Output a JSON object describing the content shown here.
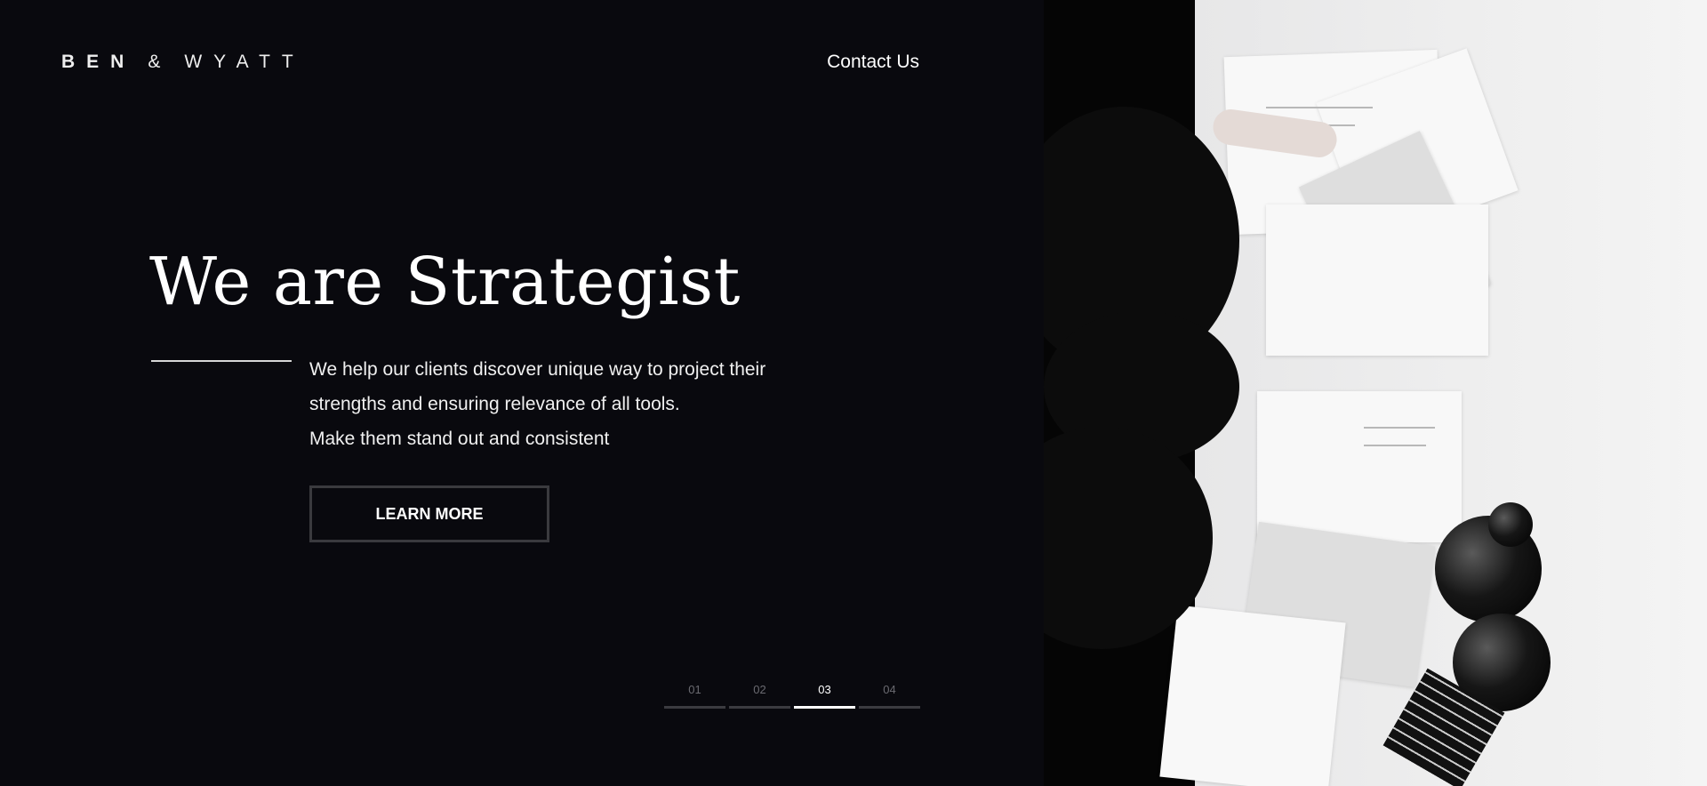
{
  "header": {
    "logo": {
      "first": "BEN",
      "amp": "&",
      "second": "WYATT"
    },
    "contact_label": "Contact Us"
  },
  "hero": {
    "title": "We are Strategist",
    "description_lines": [
      "We help our clients discover unique way to project their",
      "strengths and ensuring relevance of all tools.",
      "Make them stand out and consistent"
    ],
    "cta_label": "LEARN MORE"
  },
  "pager": {
    "items": [
      {
        "label": "01",
        "active": false
      },
      {
        "label": "02",
        "active": false
      },
      {
        "label": "03",
        "active": true
      },
      {
        "label": "04",
        "active": false
      }
    ]
  },
  "colors": {
    "background": "#09090e",
    "text": "#ffffff",
    "muted": "#6a6a70",
    "button_border": "#3a3a3e"
  }
}
